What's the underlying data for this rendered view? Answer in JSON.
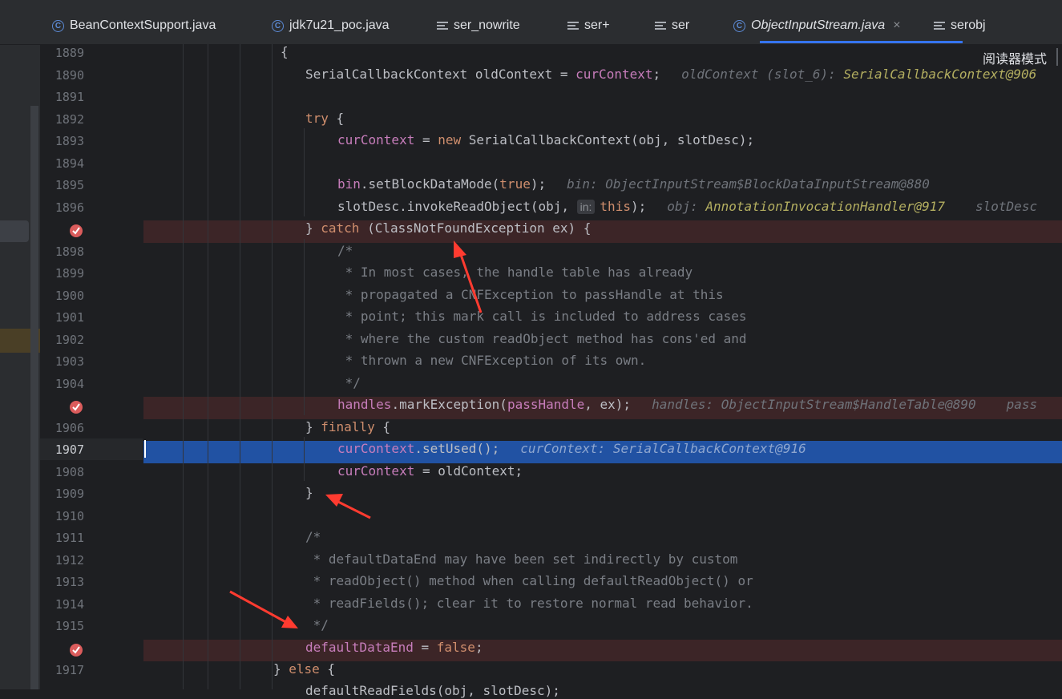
{
  "tabs": [
    {
      "label": "BeanContextSupport.java",
      "icon": "class-icon",
      "active": false
    },
    {
      "label": "jdk7u21_poc.java",
      "icon": "class-icon",
      "active": false
    },
    {
      "label": "ser_nowrite",
      "icon": "text-file-icon",
      "active": false
    },
    {
      "label": "ser+",
      "icon": "text-file-icon",
      "active": false
    },
    {
      "label": "ser",
      "icon": "text-file-icon",
      "active": false
    },
    {
      "label": "ObjectInputStream.java",
      "icon": "class-icon",
      "active": true
    },
    {
      "label": "serobj",
      "icon": "text-file-icon",
      "active": false
    }
  ],
  "tab_close": "×",
  "reader_mode_label": "阅读器模式",
  "line_numbers": [
    "1889",
    "1890",
    "1891",
    "1892",
    "1893",
    "1894",
    "1895",
    "1896",
    "",
    "1898",
    "1899",
    "1900",
    "1901",
    "1902",
    "1903",
    "1904",
    "",
    "1906",
    "1907",
    "1908",
    "1909",
    "1910",
    "1911",
    "1912",
    "1913",
    "1914",
    "1915",
    "",
    "1917"
  ],
  "current_line": "1907",
  "breakpoint_lines": [
    8,
    16,
    27
  ],
  "exec_line": 18,
  "code": {
    "l0": "{",
    "l1a": "SerialCallbackContext oldContext = ",
    "l1b": "curContext",
    "l1c": ";",
    "l1h1": "oldContext (slot_6): ",
    "l1h2": "SerialCallbackContext@906",
    "l3a": "try",
    "l3b": " {",
    "l4a": "curContext",
    "l4b": " = ",
    "l4c": "new",
    "l4d": " SerialCallbackContext(obj, slotDesc);",
    "l6a": "bin",
    "l6b": ".setBlockDataMode(",
    "l6c": "true",
    "l6d": ");",
    "l6h": "bin: ObjectInputStream$BlockDataInputStream@880",
    "l7a": "slotDesc.invokeReadObject(obj, ",
    "l7inlay": "in:",
    "l7b": "this",
    "l7c": ");",
    "l7h1": "obj: ",
    "l7h2": "AnnotationInvocationHandler@917",
    "l7h3": "slotDesc",
    "l8a": "} ",
    "l8b": "catch",
    "l8c": " (ClassNotFoundException ex) {",
    "l9": "/*",
    "l10": " * In most cases, the handle table has already",
    "l11": " * propagated a CNFException to passHandle at this",
    "l12": " * point; this mark call is included to address cases",
    "l13": " * where the custom readObject method has cons'ed and",
    "l14": " * thrown a new CNFException of its own.",
    "l15": " */",
    "l16a": "handles",
    "l16b": ".markException(",
    "l16c": "passHandle",
    "l16d": ", ex);",
    "l16h": "handles: ObjectInputStream$HandleTable@890",
    "l16h2": "pass",
    "l17a": "} ",
    "l17b": "finally",
    "l17c": " {",
    "l18a": "curContext",
    "l18b": ".setUsed();",
    "l18h": "curContext: SerialCallbackContext@916",
    "l19a": "curContext",
    "l19b": " = oldContext;",
    "l20": "}",
    "l22": "/*",
    "l23": " * defaultDataEnd may have been set indirectly by custom",
    "l24": " * readObject() method when calling defaultReadObject() or",
    "l25": " * readFields(); clear it to restore normal read behavior.",
    "l26": " */",
    "l27a": "defaultDataEnd",
    "l27b": " = ",
    "l27c": "false",
    "l27d": ";",
    "l28a": "} ",
    "l28b": "else",
    "l28c": " {",
    "l29": "defaultReadFields(obj, slotDesc);"
  },
  "colors": {
    "accent": "#3574f0",
    "breakpoint": "#db5c5c",
    "exec_line_bg": "#2152a3",
    "annotation_arrow": "#ff3b30"
  }
}
